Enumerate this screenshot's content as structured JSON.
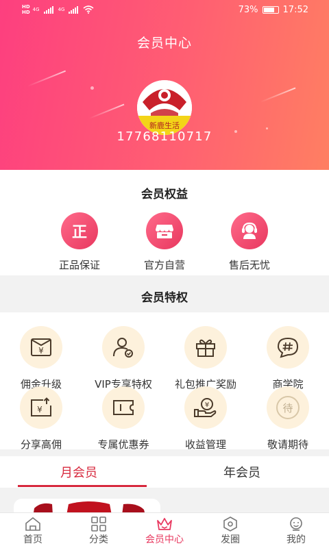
{
  "status_bar": {
    "net_top": "HD",
    "net_bottom": "HD",
    "sig1": "4G",
    "sig2": "4G",
    "battery_pct": "73%",
    "time": "17:52"
  },
  "header": {
    "title": "会员中心",
    "avatar_text": "新鹿生活",
    "phone": "17768110717"
  },
  "benefits": {
    "title": "会员权益",
    "items": [
      {
        "label": "正品保证",
        "icon": "genuine-icon",
        "glyph": "正"
      },
      {
        "label": "官方自营",
        "icon": "store-icon"
      },
      {
        "label": "售后无忧",
        "icon": "customer-service-icon"
      }
    ]
  },
  "privileges": {
    "title": "会员特权",
    "items": [
      {
        "label": "佣金升级",
        "icon": "commission-upgrade-icon"
      },
      {
        "label": "VIP专享特权",
        "icon": "vip-user-icon"
      },
      {
        "label": "礼包推广奖励",
        "icon": "gift-icon"
      },
      {
        "label": "商学院",
        "icon": "chat-hash-icon"
      },
      {
        "label": "分享高佣",
        "icon": "share-commission-icon"
      },
      {
        "label": "专属优惠券",
        "icon": "coupon-icon"
      },
      {
        "label": "收益管理",
        "icon": "earnings-icon"
      },
      {
        "label": "敬请期待",
        "icon": "coming-soon-icon",
        "glyph": "待"
      }
    ]
  },
  "tabs": [
    {
      "label": "月会员",
      "active": true
    },
    {
      "label": "年会员",
      "active": false
    }
  ],
  "bottom_nav": [
    {
      "label": "首页",
      "icon": "home-icon"
    },
    {
      "label": "分类",
      "icon": "category-grid-icon"
    },
    {
      "label": "会员中心",
      "icon": "crown-icon",
      "active": true
    },
    {
      "label": "发圈",
      "icon": "hexagon-icon"
    },
    {
      "label": "我的",
      "icon": "profile-icon"
    }
  ],
  "colors": {
    "accent": "#e8385f",
    "tab_active": "#d7283d",
    "icon_bg": "#fdf1dc",
    "icon_stroke": "#4a3a2a"
  }
}
